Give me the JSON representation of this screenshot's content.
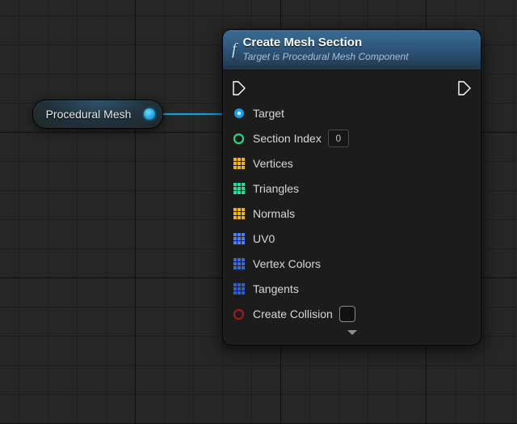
{
  "variable_node": {
    "label": "Procedural Mesh"
  },
  "fn_node": {
    "title": "Create Mesh Section",
    "subtitle": "Target is Procedural Mesh Component",
    "pins": {
      "target": {
        "label": "Target"
      },
      "section_index": {
        "label": "Section Index",
        "value": "0"
      },
      "vertices": {
        "label": "Vertices"
      },
      "triangles": {
        "label": "Triangles"
      },
      "normals": {
        "label": "Normals"
      },
      "uv0": {
        "label": "UV0"
      },
      "vertex_colors": {
        "label": "Vertex Colors"
      },
      "tangents": {
        "label": "Tangents"
      },
      "create_collision": {
        "label": "Create Collision",
        "value": false
      }
    }
  },
  "colors": {
    "object": "#18a0e0",
    "int": "#1fd47a",
    "vector": "#f0b515",
    "intarr": "#22e09a",
    "v2d": "#4f7dff",
    "lcolor": "#3e67d6",
    "struct": "#2f5fcf",
    "bool": "#9b1b1b"
  }
}
